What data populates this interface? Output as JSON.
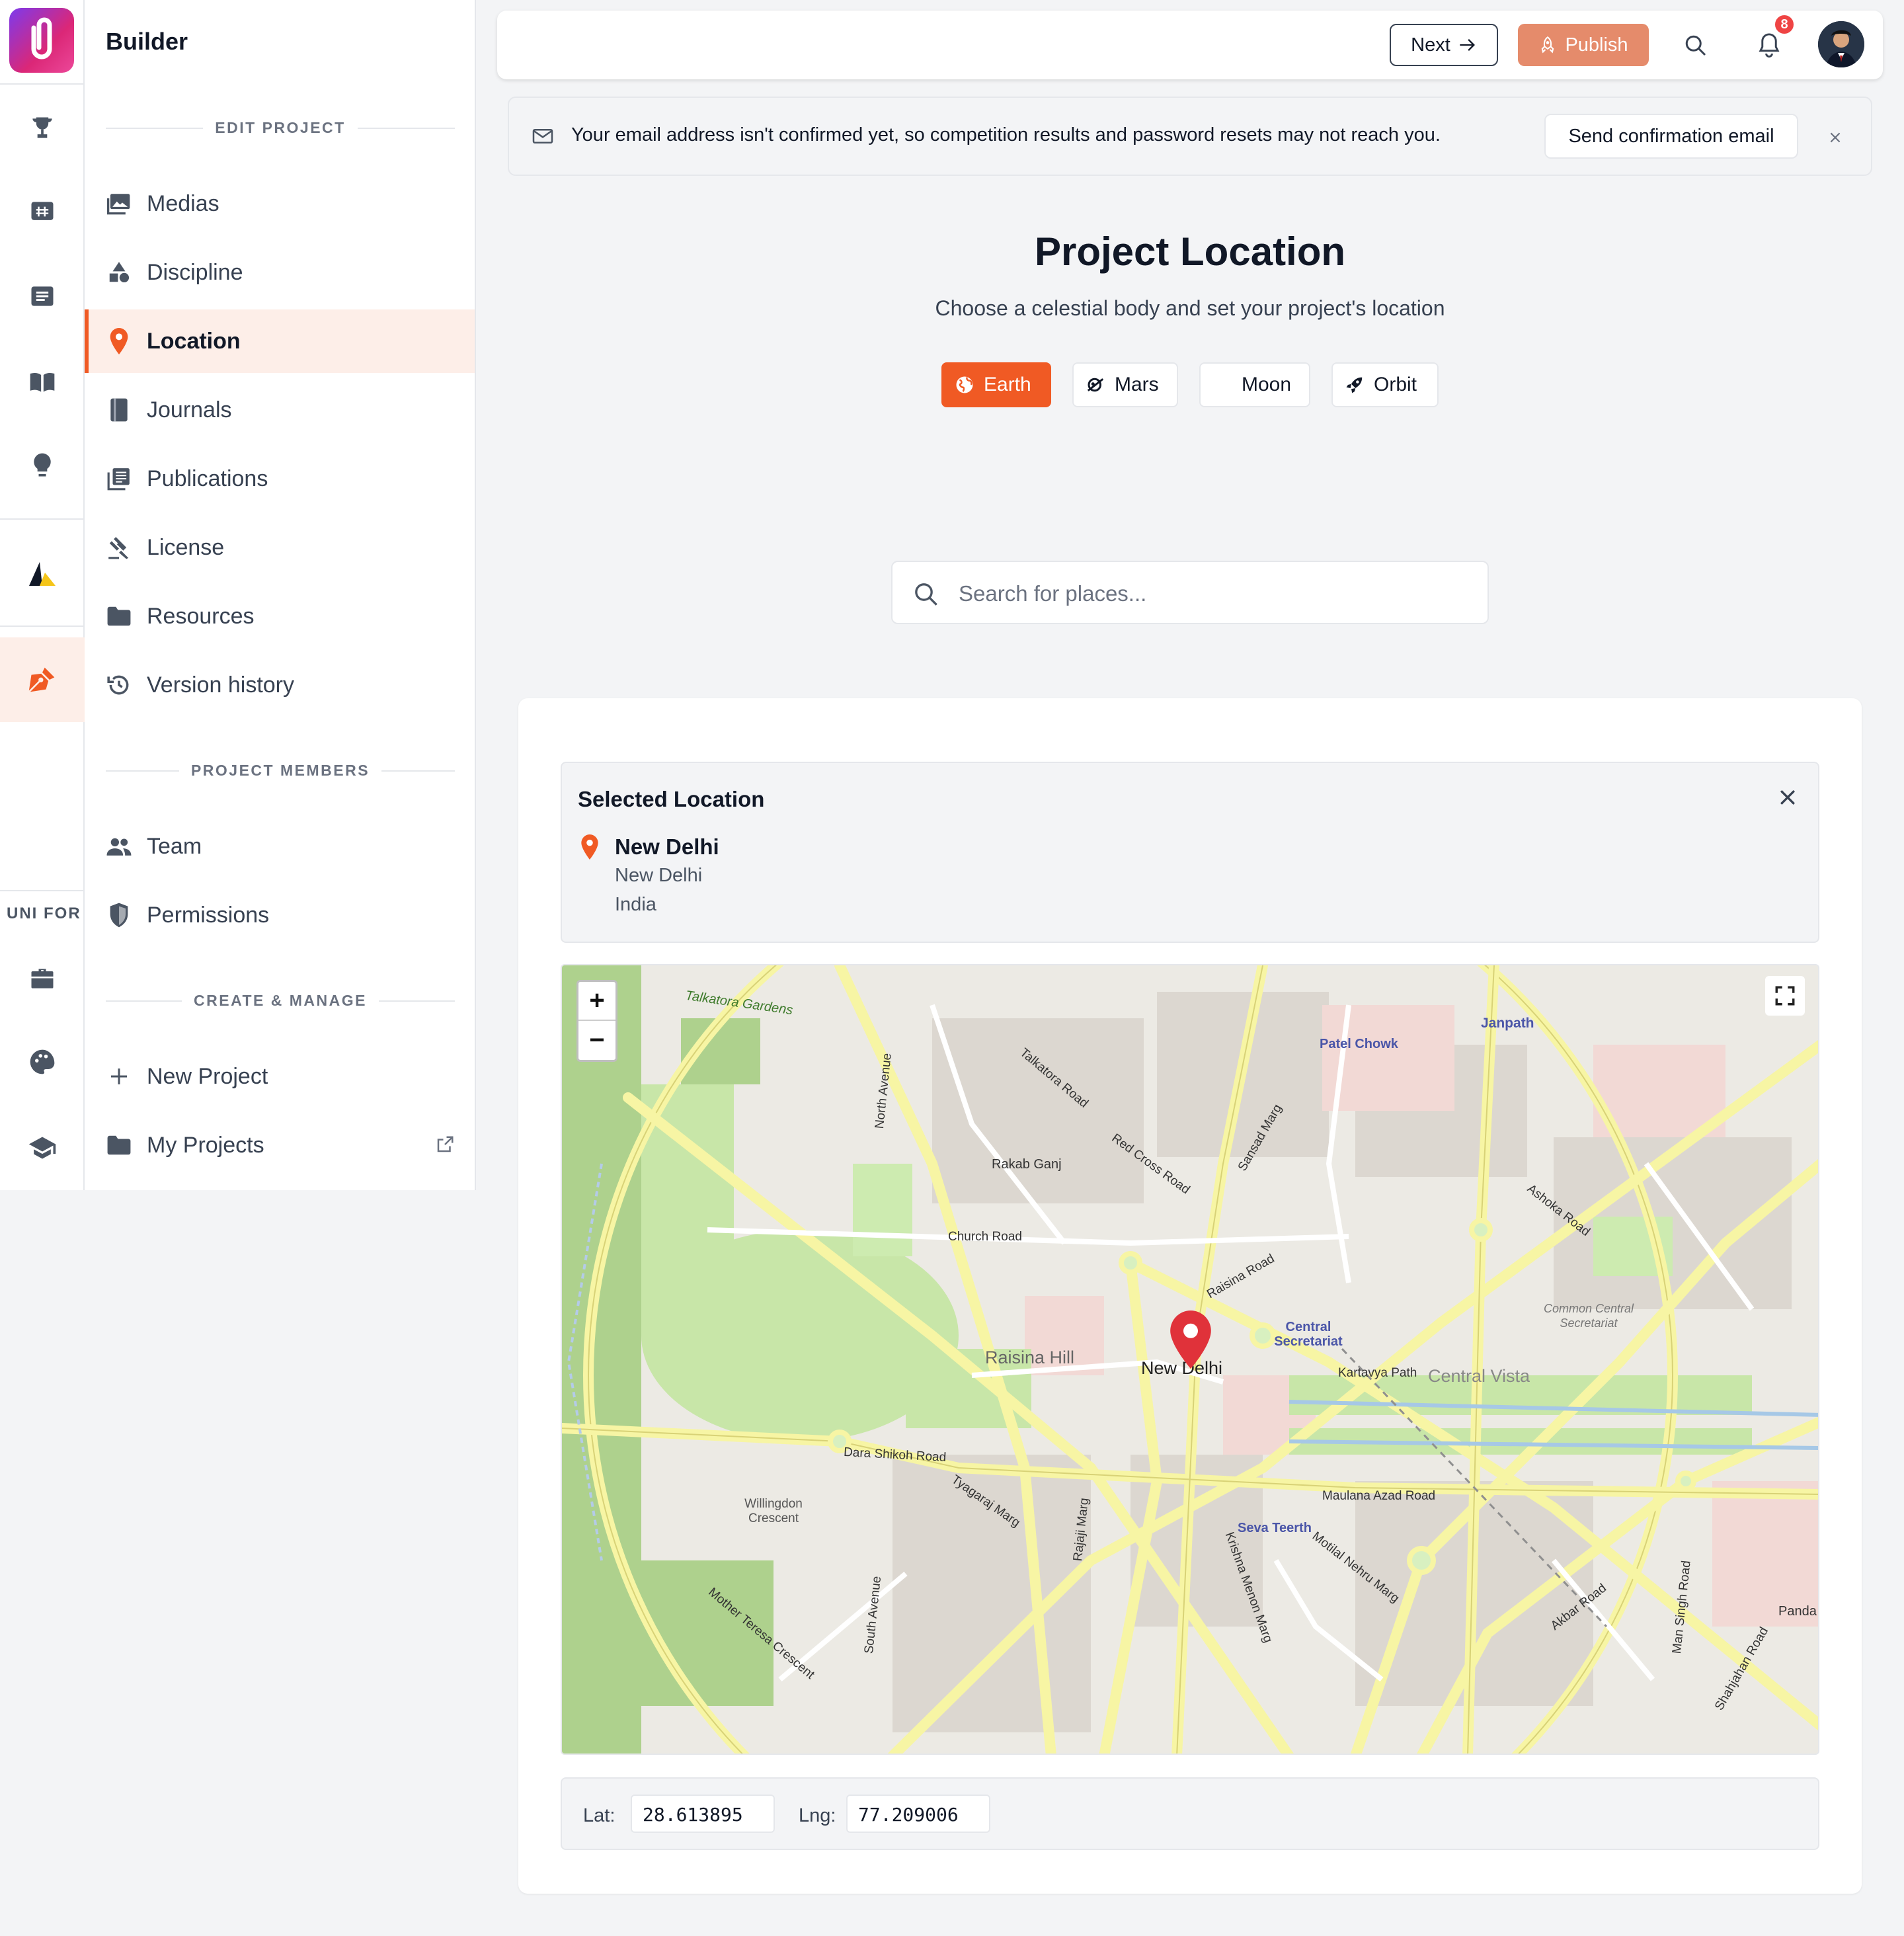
{
  "app": {
    "brand": "Builder",
    "rail_label": "UNI FOR"
  },
  "sidebar": {
    "sections": {
      "edit": "EDIT PROJECT",
      "members": "PROJECT MEMBERS",
      "create": "CREATE & MANAGE"
    },
    "edit_items": [
      {
        "label": "Medias",
        "icon": "images-icon"
      },
      {
        "label": "Discipline",
        "icon": "shapes-icon"
      },
      {
        "label": "Location",
        "icon": "map-pin-icon",
        "active": true
      },
      {
        "label": "Journals",
        "icon": "journal-icon"
      },
      {
        "label": "Publications",
        "icon": "publications-icon"
      },
      {
        "label": "License",
        "icon": "gavel-icon"
      },
      {
        "label": "Resources",
        "icon": "folder-icon"
      },
      {
        "label": "Version history",
        "icon": "history-icon"
      }
    ],
    "member_items": [
      {
        "label": "Team",
        "icon": "team-icon"
      },
      {
        "label": "Permissions",
        "icon": "shield-icon"
      }
    ],
    "create_items": [
      {
        "label": "New Project",
        "icon": "plus-icon"
      },
      {
        "label": "My Projects",
        "icon": "folder-icon"
      }
    ]
  },
  "topbar": {
    "next_label": "Next",
    "publish_label": "Publish",
    "notification_count": "8"
  },
  "alert": {
    "message": "Your email address isn't confirmed yet, so competition results and password resets may not reach you.",
    "action_label": "Send confirmation email"
  },
  "page": {
    "title": "Project Location",
    "subtitle": "Choose a celestial body and set your project's location",
    "bodies": [
      {
        "label": "Earth",
        "selected": true
      },
      {
        "label": "Mars",
        "selected": false
      },
      {
        "label": "Moon",
        "selected": false
      },
      {
        "label": "Orbit",
        "selected": false
      }
    ],
    "search_placeholder": "Search for places..."
  },
  "selected_location": {
    "heading": "Selected Location",
    "name": "New Delhi",
    "line2": "New Delhi",
    "line3": "India"
  },
  "map": {
    "zoom_in": "+",
    "zoom_out": "−",
    "labels": [
      "Talkatora Gardens",
      "Rakab Ganj",
      "Church Road",
      "North Avenue",
      "Patel Chowk",
      "Janpath",
      "Central Secretariat",
      "Raisina Hill",
      "New Delhi",
      "Central Vista",
      "Kartavya Path",
      "Dara Shikoh Road",
      "Willingdon Crescent",
      "Maulana Azad Road",
      "Seva Teerth",
      "Akbar Road",
      "Ashoka Road",
      "South Avenue",
      "Mother Teresa Crescent",
      "Common Central Secretariat",
      "Raisina Road",
      "Motilal Nehru Marg",
      "Krishna Menon Marg",
      "Tyagaraj Marg",
      "Rajaji Marg",
      "Man Singh Road",
      "Shahjahan Road",
      "Red Cross Road",
      "Talkatora Road",
      "Sansad Marg",
      "Panda"
    ]
  },
  "coords": {
    "lat_label": "Lat:",
    "lat": "28.613895",
    "lng_label": "Lng:",
    "lng": "77.209006"
  },
  "colors": {
    "accent": "#f05a24",
    "publish": "#e58b6b",
    "active_bg": "#fdeee8",
    "pin": "#e0323a"
  }
}
